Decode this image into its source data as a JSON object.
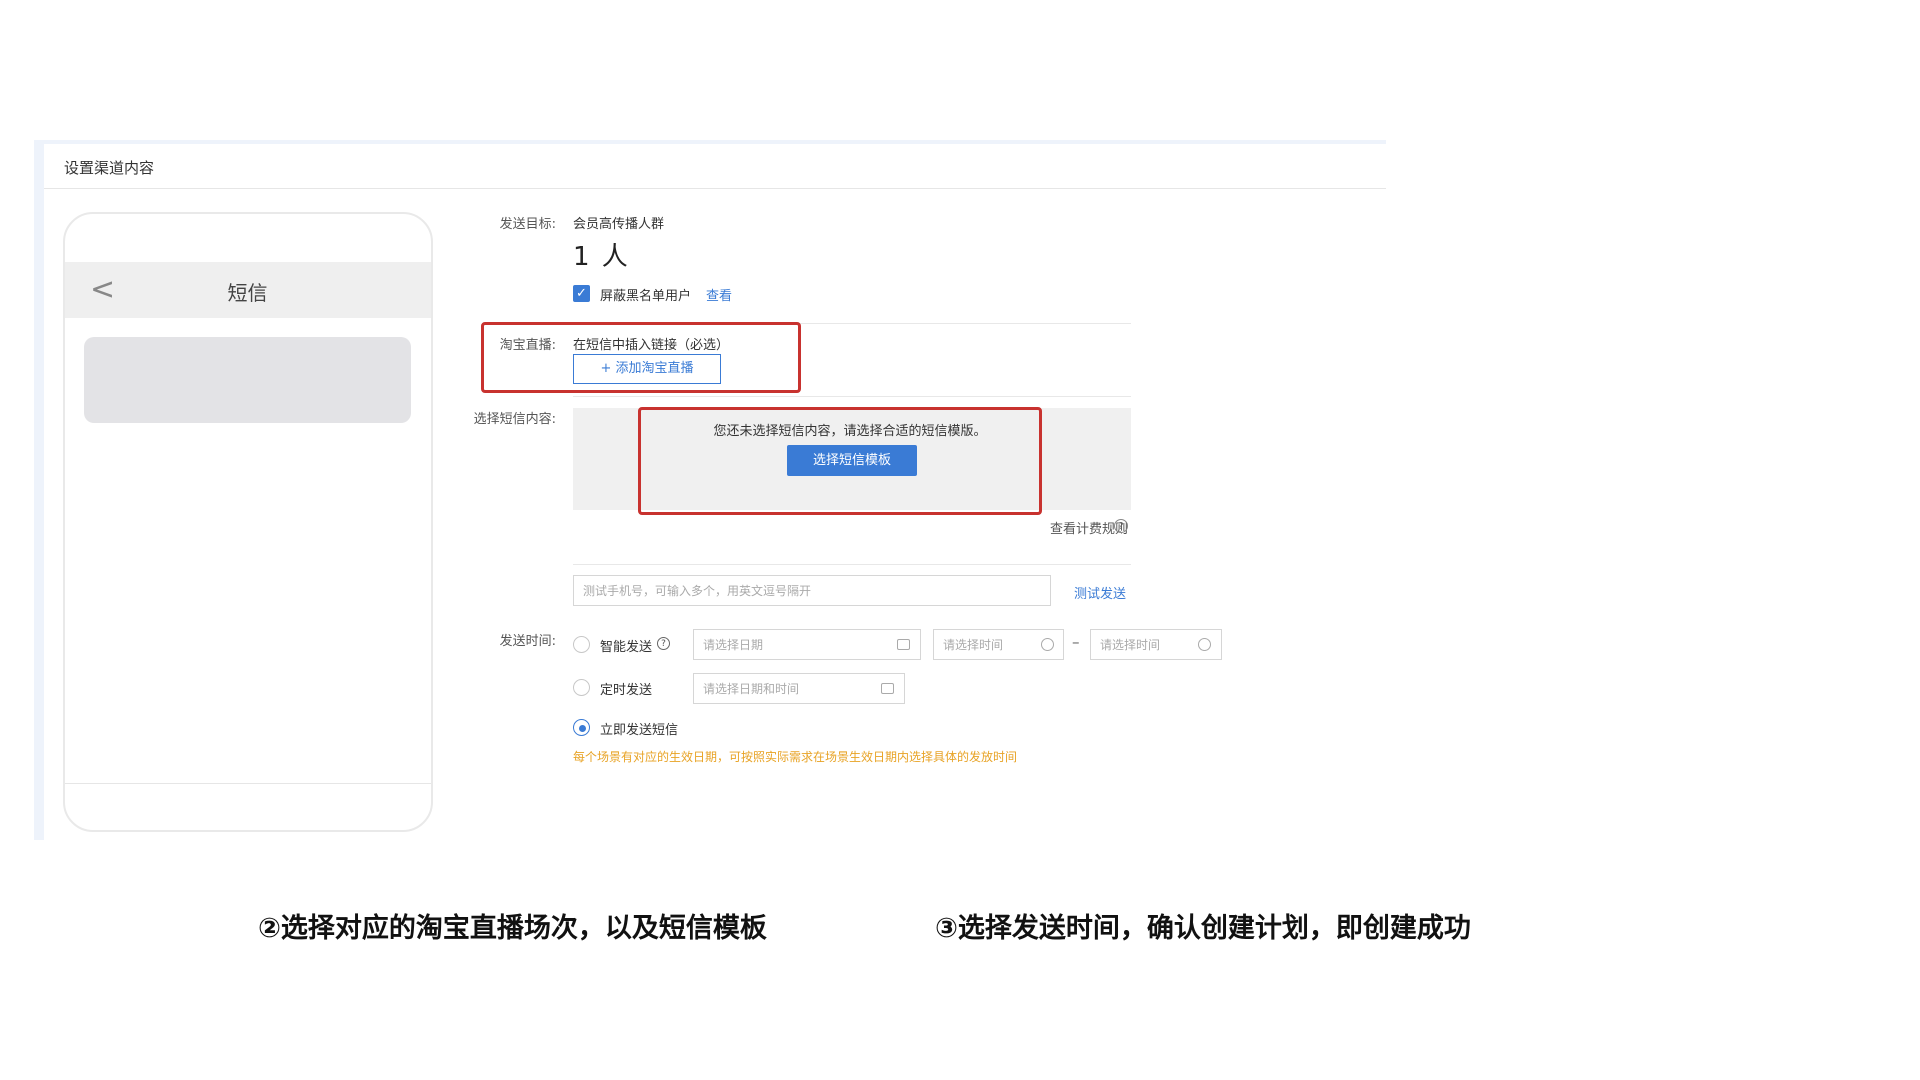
{
  "panel": {
    "title": "设置渠道内容"
  },
  "phone": {
    "back": "<",
    "title": "短信"
  },
  "form": {
    "target_label": "发送目标:",
    "target_value": "会员高传播人群",
    "count": "1 人",
    "blacklist_label": "屏蔽黑名单用户",
    "view_link": "查看",
    "live_label": "淘宝直播:",
    "live_hint": "在短信中插入链接（必选）",
    "add_live_button": "+ 添加淘宝直播",
    "content_label": "选择短信内容:",
    "content_hint": "您还未选择短信内容，请选择合适的短信模版。",
    "choose_template_button": "选择短信模板",
    "billing_rules": "查看计费规则",
    "billing_q": "?",
    "phone_placeholder": "测试手机号，可输入多个，用英文逗号隔开",
    "test_send": "测试发送",
    "time_label": "发送时间:",
    "smart_send": "智能发送",
    "smart_q": "?",
    "date_placeholder": "请选择日期",
    "time_start_placeholder": "请选择时间",
    "dash": "–",
    "time_end_placeholder": "请选择时间",
    "timed_send": "定时发送",
    "datetime_placeholder": "请选择日期和时间",
    "send_now": "立即发送短信",
    "note": "每个场景有对应的生效日期，可按照实际需求在场景生效日期内选择具体的发放时间"
  },
  "captions": {
    "step2": "②选择对应的淘宝直播场次，以及短信模板",
    "step3": "③选择发送时间，确认创建计划，即创建成功"
  },
  "colors": {
    "accent": "#3a7bd5",
    "highlight_box": "#c8322f",
    "note": "#e8a325"
  }
}
